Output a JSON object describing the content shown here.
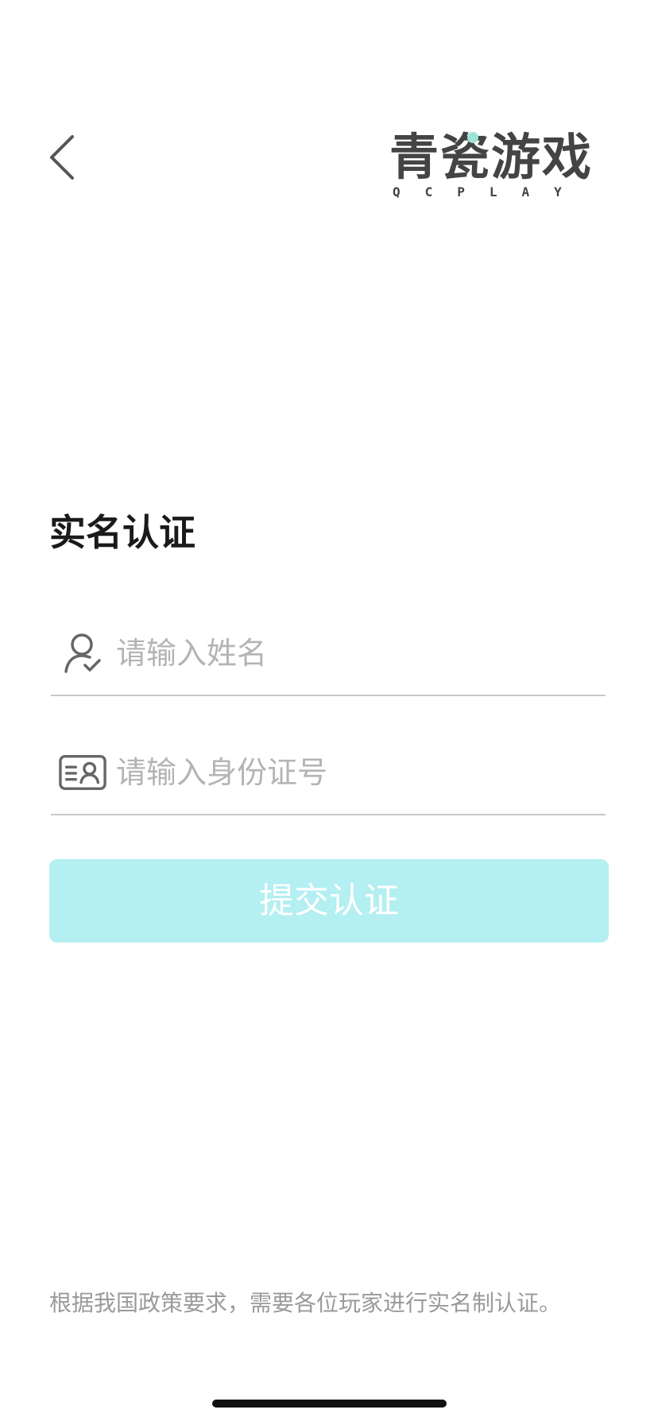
{
  "header": {
    "back_icon": "chevron-left-icon",
    "logo": {
      "chinese_text": "青瓷游戏",
      "english_text": "QCPLAY",
      "accent_color": "#9fe3d6"
    }
  },
  "form": {
    "title": "实名认证",
    "name_field": {
      "icon": "user-check-icon",
      "placeholder": "请输入姓名",
      "value": ""
    },
    "id_field": {
      "icon": "id-card-icon",
      "placeholder": "请输入身份证号",
      "value": ""
    },
    "submit_label": "提交认证",
    "submit_color": "#b4eff2"
  },
  "footer": {
    "notice": "根据我国政策要求，需要各位玩家进行实名制认证。"
  }
}
